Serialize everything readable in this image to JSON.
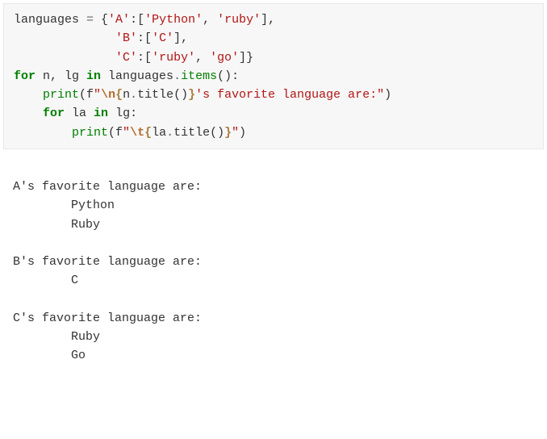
{
  "code": {
    "t1": "languages ",
    "t2": "=",
    "t3": " {",
    "t4": "'A'",
    "t5": ":[",
    "t6": "'Python'",
    "t7": ", ",
    "t8": "'ruby'",
    "t9": "],",
    "t10": "              ",
    "t11": "'B'",
    "t12": ":[",
    "t13": "'C'",
    "t14": "],",
    "t15": "              ",
    "t16": "'C'",
    "t17": ":[",
    "t18": "'ruby'",
    "t19": ", ",
    "t20": "'go'",
    "t21": "]}",
    "t22": "for",
    "t23": " n, lg ",
    "t24": "in",
    "t25": " languages",
    "t26": ".",
    "t27": "items",
    "t28": "():",
    "t29": "    ",
    "t30": "print",
    "t31": "(f",
    "t32": "\"",
    "t33": "\\n",
    "t34": "{",
    "t35": "n",
    "t36": ".",
    "t37": "title()",
    "t38": "}",
    "t39": "'s favorite language are:\"",
    "t40": ")",
    "t41": "    ",
    "t42": "for",
    "t43": " la ",
    "t44": "in",
    "t45": " lg:",
    "t46": "        ",
    "t47": "print",
    "t48": "(f",
    "t49": "\"",
    "t50": "\\t",
    "t51": "{",
    "t52": "la",
    "t53": ".",
    "t54": "title()",
    "t55": "}",
    "t56": "\"",
    "t57": ")"
  },
  "output": {
    "l1": "A's favorite language are:",
    "l2": "        Python",
    "l3": "        Ruby",
    "l4": "",
    "l5": "B's favorite language are:",
    "l6": "        C",
    "l7": "",
    "l8": "C's favorite language are:",
    "l9": "        Ruby",
    "l10": "        Go"
  }
}
